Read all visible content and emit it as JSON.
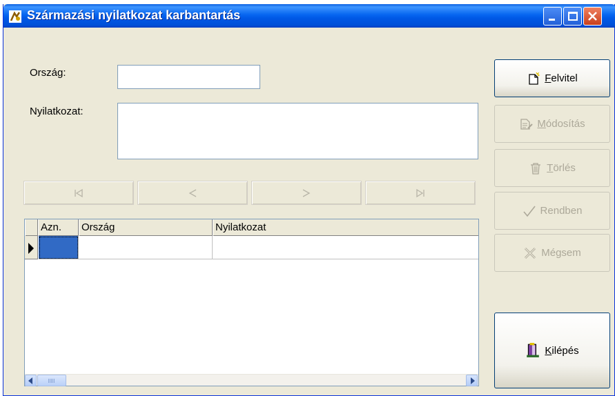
{
  "window": {
    "title": "Származási nyilatkozat karbantartás"
  },
  "form": {
    "orszag_label": "Ország:",
    "orszag_value": "",
    "nyilatkozat_label": "Nyilatkozat:",
    "nyilatkozat_value": ""
  },
  "navigation": {
    "first_icon": "first-record-icon",
    "prev_icon": "prev-record-icon",
    "next_icon": "next-record-icon",
    "last_icon": "last-record-icon"
  },
  "grid": {
    "columns": [
      "Azn.",
      "Ország",
      "Nyilatkozat"
    ],
    "rows": [
      {
        "azn": "",
        "orszag": "",
        "nyilatkozat": ""
      }
    ]
  },
  "actions": {
    "felvitel": {
      "hotkey": "F",
      "rest": "elvitel",
      "enabled": true,
      "icon": "new-document-icon"
    },
    "modositas": {
      "hotkey": "M",
      "rest": "ódosítás",
      "enabled": false,
      "icon": "edit-document-icon"
    },
    "torles": {
      "hotkey": "T",
      "rest": "örlés",
      "enabled": false,
      "icon": "trash-icon"
    },
    "rendben": {
      "label": "Rendben",
      "enabled": false,
      "icon": "checkmark-icon"
    },
    "megsem": {
      "label": "Mégsem",
      "enabled": false,
      "icon": "cancel-x-icon"
    },
    "kilepes": {
      "hotkey": "K",
      "rest": "ilépés",
      "enabled": true,
      "icon": "exit-door-icon"
    }
  },
  "colors": {
    "titlebar": "#0058e6",
    "window_bg": "#ece9d8",
    "selection": "#316ac5"
  }
}
